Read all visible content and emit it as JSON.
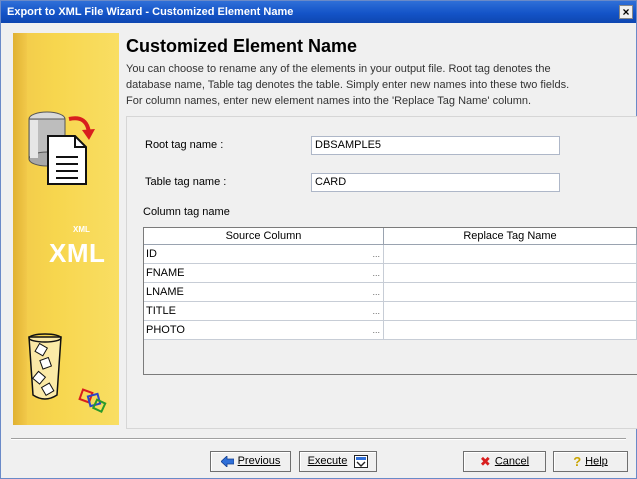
{
  "window": {
    "title": "Export to XML File Wizard - Customized Element Name",
    "close_glyph": "×"
  },
  "sidebar": {
    "xml_big": "XML",
    "xml_small": "XML"
  },
  "heading": "Customized Element Name",
  "description": [
    "You can choose to rename any of the  elements in your output file. Root tag denotes the",
    "database name, Table tag denotes the table. Simply enter new names into these two fields.",
    "For column names, enter new element names into the 'Replace Tag Name' column."
  ],
  "form": {
    "root_label": "Root tag name :",
    "root_value": "DBSAMPLE5",
    "table_label": "Table tag name :",
    "table_value": "CARD",
    "column_label": "Column tag name"
  },
  "grid": {
    "headers": [
      "Source Column",
      "Replace Tag Name"
    ],
    "rows": [
      {
        "source": "ID",
        "replace": ""
      },
      {
        "source": "FNAME",
        "replace": ""
      },
      {
        "source": "LNAME",
        "replace": ""
      },
      {
        "source": "TITLE",
        "replace": ""
      },
      {
        "source": "PHOTO",
        "replace": ""
      }
    ],
    "ellipsis": "..."
  },
  "buttons": {
    "previous": "Previous",
    "execute": "Execute",
    "cancel": "Cancel",
    "help": "Help"
  },
  "colors": {
    "titlebar": "#1454c8",
    "sidebar": "#f7d64e",
    "accent_red": "#d81e1e"
  }
}
